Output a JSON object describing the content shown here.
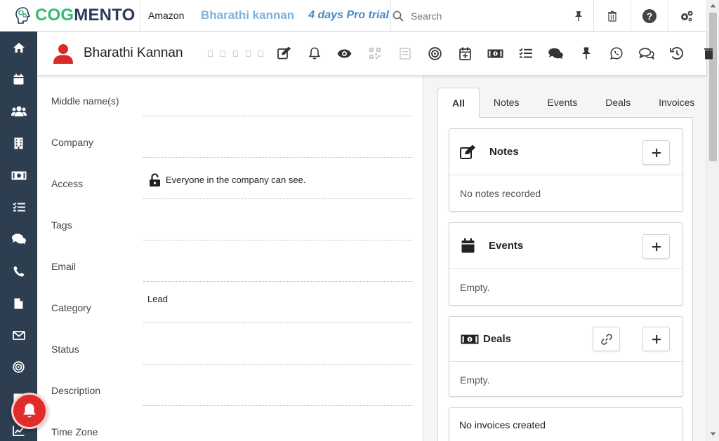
{
  "brand": {
    "logo_text_1": "COG",
    "logo_text_2": "MENTO"
  },
  "topbar": {
    "account": "Amazon",
    "user_name": "Bharathi kannan",
    "trial": "4 days Pro trial",
    "search_placeholder": "Search"
  },
  "sidebar": {
    "items": [
      "home-icon",
      "calendar-icon",
      "contacts-icon",
      "companies-icon",
      "deals-icon",
      "tasks-icon",
      "chat-icon",
      "phone-icon",
      "documents-icon",
      "email-icon",
      "campaigns-icon",
      "forms-icon",
      "reports-icon"
    ]
  },
  "contact": {
    "name": "Bharathi Kannan"
  },
  "form": {
    "fields": [
      {
        "label": "Middle name(s)",
        "value": ""
      },
      {
        "label": "Company",
        "value": ""
      },
      {
        "label": "Access",
        "value": "Everyone in the company can see."
      },
      {
        "label": "Tags",
        "value": ""
      },
      {
        "label": "Email",
        "value": ""
      },
      {
        "label": "Category",
        "value": "Lead"
      },
      {
        "label": "Status",
        "value": ""
      },
      {
        "label": "Description",
        "value": ""
      },
      {
        "label": "Time Zone",
        "value": ""
      }
    ]
  },
  "right": {
    "tabs": [
      "All",
      "Notes",
      "Events",
      "Deals",
      "Invoices"
    ],
    "active_tab": "All",
    "cards": {
      "notes": {
        "title": "Notes",
        "body": "No notes recorded"
      },
      "events": {
        "title": "Events",
        "body": "Empty."
      },
      "deals": {
        "title": "Deals",
        "body": "Empty."
      },
      "invoices": {
        "body": "No invoices created"
      }
    }
  },
  "colors": {
    "sidebar": "#2d3e50",
    "brand_green": "#33bb77",
    "brand_dark": "#2a3a5a",
    "avatar_red": "#db2828",
    "notif_red": "#e22b2b"
  }
}
